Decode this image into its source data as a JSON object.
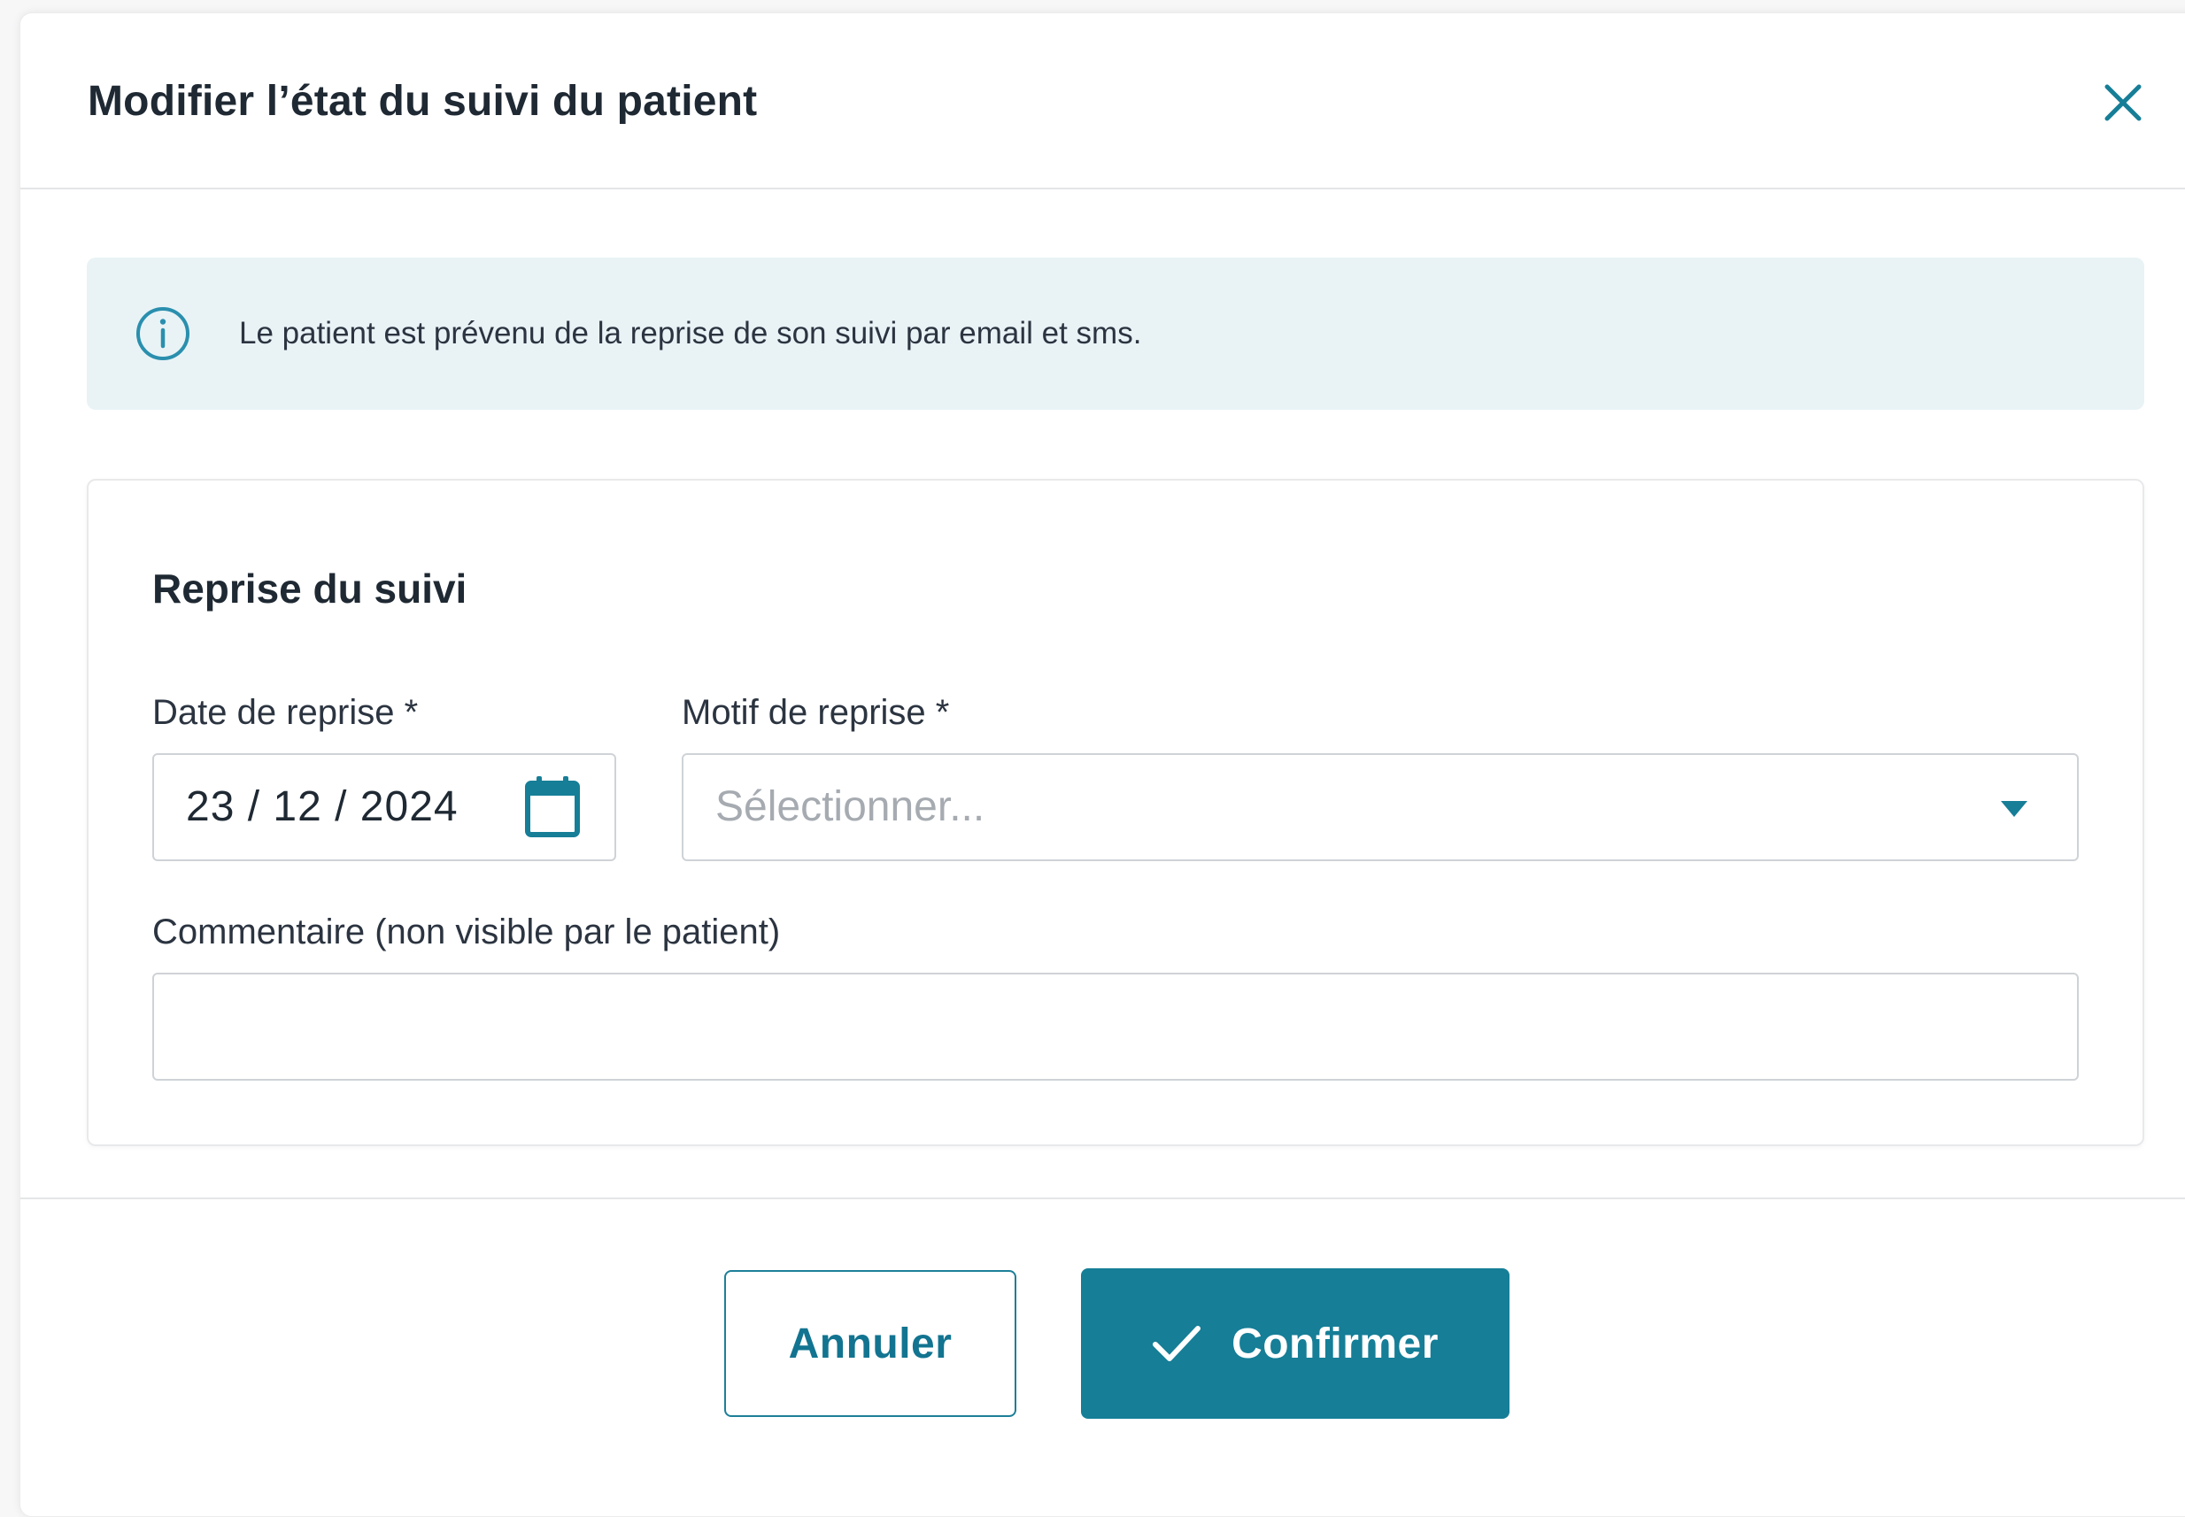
{
  "modal": {
    "title": "Modifier l’état du suivi du patient",
    "close_icon": "close-icon"
  },
  "info": {
    "icon": "info-icon",
    "text": "Le patient est prévenu de la reprise de son suivi par email et sms."
  },
  "section": {
    "title": "Reprise du suivi",
    "date_field": {
      "label": "Date de reprise *",
      "value": "23 / 12 / 2024",
      "icon": "calendar-icon"
    },
    "reason_field": {
      "label": "Motif de reprise *",
      "placeholder": "Sélectionner...",
      "icon": "chevron-down-icon"
    },
    "comment_field": {
      "label": "Commentaire (non visible par le patient)",
      "value": ""
    }
  },
  "footer": {
    "cancel_label": "Annuler",
    "confirm_label": "Confirmer",
    "confirm_icon": "check-icon"
  },
  "colors": {
    "accent": "#167e97",
    "info_bg": "#e9f3f6",
    "border": "#cfd3d7"
  }
}
